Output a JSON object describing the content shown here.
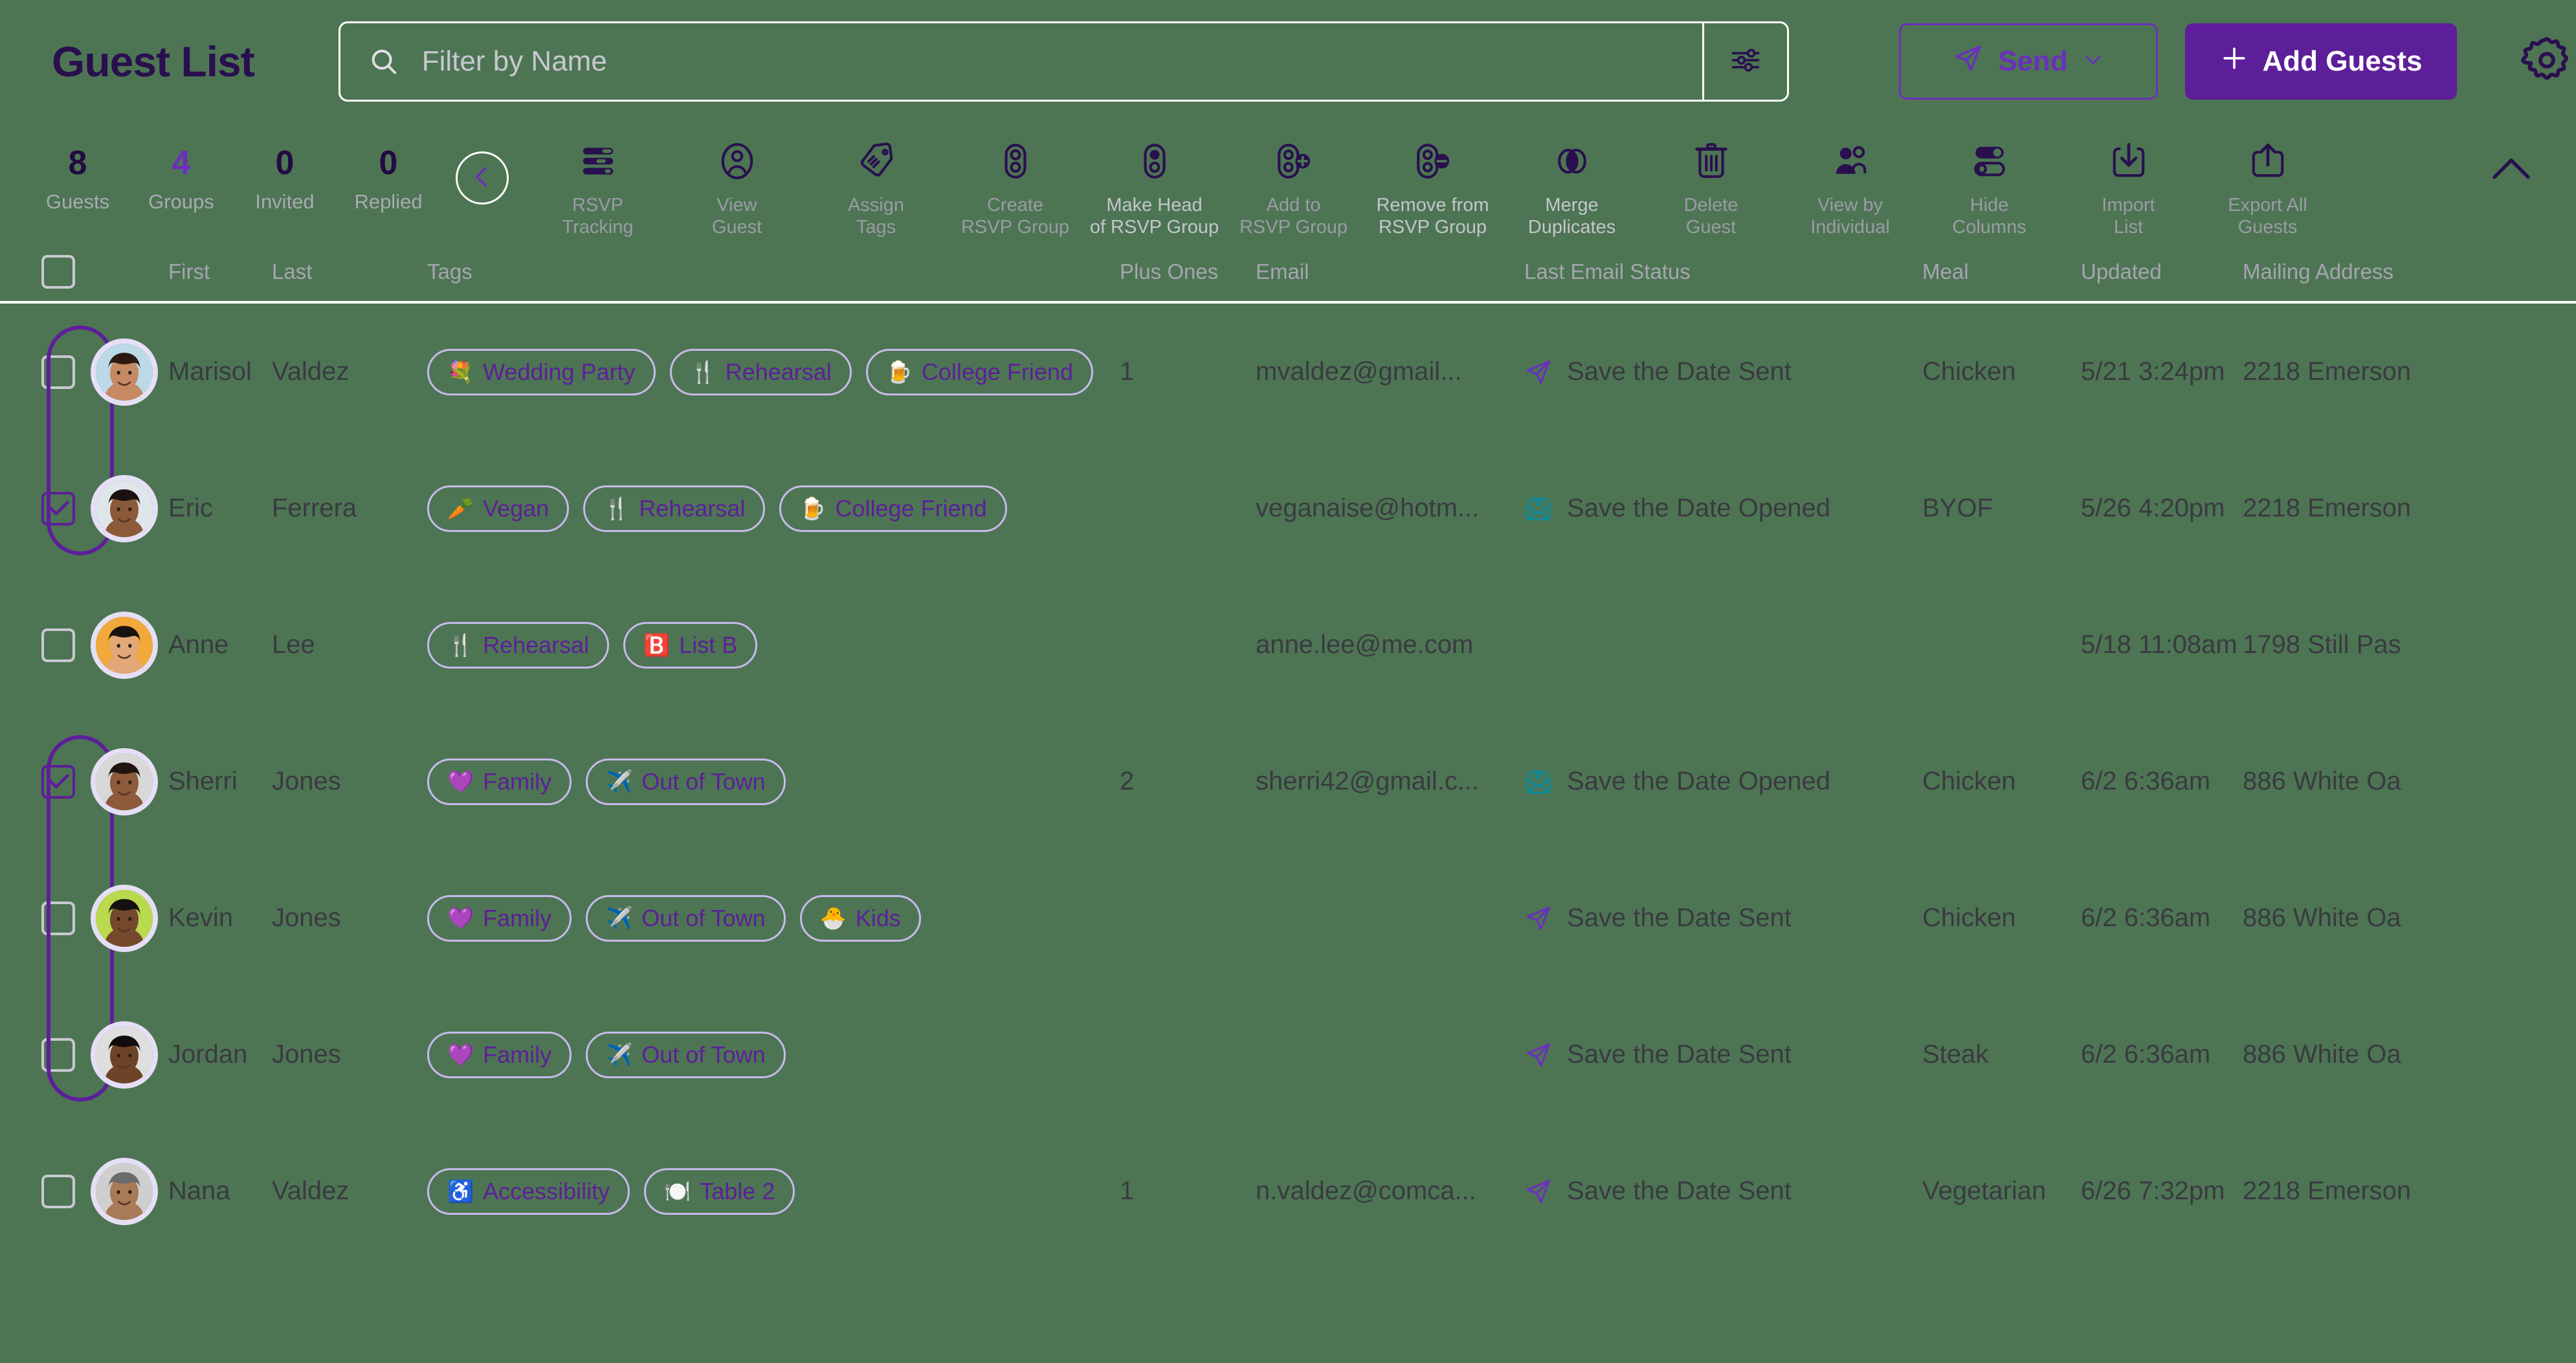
{
  "header": {
    "title": "Guest List",
    "search_placeholder": "Filter by Name",
    "search_value": "",
    "filter_icon": "sliders-icon",
    "search_icon": "search-icon",
    "send_label": "Send",
    "send_icon": "paper-plane-icon",
    "send_chevron": "chevron-down-icon",
    "add_label": "Add Guests",
    "add_icon": "plus-icon",
    "settings_icon": "gear-icon"
  },
  "colors": {
    "background": "#4d7553",
    "title": "#2a0f4f",
    "accent_purple": "#5d1f99",
    "accent_purple_light": "#6b2fbd",
    "tag_border": "#c8b9ec",
    "status_opened_teal": "#0d8c9e",
    "muted_label": "#a5a5b0",
    "disabled_label": "#c5c5cd"
  },
  "stats": [
    {
      "value": "8",
      "label": "Guests",
      "accent": false
    },
    {
      "value": "4",
      "label": "Groups",
      "accent": true
    },
    {
      "value": "0",
      "label": "Invited",
      "accent": false
    },
    {
      "value": "0",
      "label": "Replied",
      "accent": false
    }
  ],
  "collapse_icon": "chevron-left-icon",
  "expand_icon": "chevron-up-icon",
  "tools": [
    {
      "label": "RSVP\nTracking",
      "icon": "rsvp-tracking-icon",
      "disabled": false
    },
    {
      "label": "View\nGuest",
      "icon": "view-guest-icon",
      "disabled": false
    },
    {
      "label": "Assign\nTags",
      "icon": "assign-tags-icon",
      "disabled": false
    },
    {
      "label": "Create\nRSVP Group",
      "icon": "create-rsvp-group-icon",
      "disabled": false
    },
    {
      "label": "Make Head\nof RSVP Group",
      "icon": "make-head-rsvp-group-icon",
      "disabled": true
    },
    {
      "label": "Add to\nRSVP Group",
      "icon": "add-to-rsvp-group-icon",
      "disabled": false
    },
    {
      "label": "Remove from\nRSVP Group",
      "icon": "remove-from-rsvp-group-icon",
      "disabled": true
    },
    {
      "label": "Merge\nDuplicates",
      "icon": "merge-duplicates-icon",
      "disabled": true
    },
    {
      "label": "Delete\nGuest",
      "icon": "delete-guest-icon",
      "disabled": false
    },
    {
      "label": "View by\nIndividual",
      "icon": "view-by-individual-icon",
      "disabled": false
    },
    {
      "label": "Hide\nColumns",
      "icon": "hide-columns-icon",
      "disabled": false
    },
    {
      "label": "Import\nList",
      "icon": "import-list-icon",
      "disabled": false
    },
    {
      "label": "Export All\nGuests",
      "icon": "export-all-guests-icon",
      "disabled": false
    }
  ],
  "table": {
    "columns": [
      "First",
      "Last",
      "Tags",
      "Plus Ones",
      "Email",
      "Last Email Status",
      "Meal",
      "Updated",
      "Mailing Address"
    ],
    "select_all_checked": false,
    "rows": [
      {
        "checked": false,
        "first": "Marisol",
        "last": "Valdez",
        "tags": [
          {
            "emoji": "💐",
            "label": "Wedding Party"
          },
          {
            "emoji": "🍴",
            "label": "Rehearsal"
          },
          {
            "emoji": "🍺",
            "label": "College Friend"
          }
        ],
        "plus_ones": "1",
        "email": "mvaldez@gmail...",
        "status": "Save the Date Sent",
        "status_type": "sent",
        "meal": "Chicken",
        "updated": "5/21 3:24pm",
        "address": "2218 Emerson",
        "avatar": {
          "skin": "#c58a63",
          "hair": "#2c1a12",
          "bg": "#bcd9e8"
        },
        "group": "top"
      },
      {
        "checked": true,
        "first": "Eric",
        "last": "Ferrera",
        "tags": [
          {
            "emoji": "🥕",
            "label": "Vegan"
          },
          {
            "emoji": "🍴",
            "label": "Rehearsal"
          },
          {
            "emoji": "🍺",
            "label": "College Friend"
          }
        ],
        "plus_ones": "",
        "email": "veganaise@hotm...",
        "status": "Save the Date Opened",
        "status_type": "opened",
        "meal": "BYOF",
        "updated": "5/26 4:20pm",
        "address": "2218 Emerson",
        "avatar": {
          "skin": "#8a5a39",
          "hair": "#1b1110",
          "bg": "#dfe6ea"
        },
        "group": "bottom"
      },
      {
        "checked": false,
        "first": "Anne",
        "last": "Lee",
        "tags": [
          {
            "emoji": "🍴",
            "label": "Rehearsal"
          },
          {
            "emoji": "🅱️",
            "label": "List B"
          }
        ],
        "plus_ones": "",
        "email": "anne.lee@me.com",
        "status": "",
        "status_type": "none",
        "meal": "",
        "updated": "5/18 11:08am",
        "address": "1798 Still Pas",
        "avatar": {
          "skin": "#e2a878",
          "hair": "#19130f",
          "bg": "#f0a93a"
        },
        "group": "none"
      },
      {
        "checked": true,
        "first": "Sherri",
        "last": "Jones",
        "tags": [
          {
            "emoji": "💜",
            "label": "Family"
          },
          {
            "emoji": "✈️",
            "label": "Out of Town"
          }
        ],
        "plus_ones": "2",
        "email": "sherri42@gmail.c...",
        "status": "Save the Date Opened",
        "status_type": "opened",
        "meal": "Chicken",
        "updated": "6/2 6:36am",
        "address": "886 White Oa",
        "avatar": {
          "skin": "#8d5b3c",
          "hair": "#221510",
          "bg": "#d8d8d8"
        },
        "group": "top"
      },
      {
        "checked": false,
        "first": "Kevin",
        "last": "Jones",
        "tags": [
          {
            "emoji": "💜",
            "label": "Family"
          },
          {
            "emoji": "✈️",
            "label": "Out of Town"
          },
          {
            "emoji": "🐣",
            "label": "Kids"
          }
        ],
        "plus_ones": "",
        "email": "",
        "status": "Save the Date Sent",
        "status_type": "sent",
        "meal": "Chicken",
        "updated": "6/2 6:36am",
        "address": "886 White Oa",
        "avatar": {
          "skin": "#74492c",
          "hair": "#161010",
          "bg": "#b9da4e"
        },
        "group": "mid"
      },
      {
        "checked": false,
        "first": "Jordan",
        "last": "Jones",
        "tags": [
          {
            "emoji": "💜",
            "label": "Family"
          },
          {
            "emoji": "✈️",
            "label": "Out of Town"
          }
        ],
        "plus_ones": "",
        "email": "",
        "status": "Save the Date Sent",
        "status_type": "sent",
        "meal": "Steak",
        "updated": "6/2 6:36am",
        "address": "886 White Oa",
        "avatar": {
          "skin": "#6d4428",
          "hair": "#120d0c",
          "bg": "#dedede"
        },
        "group": "bottom"
      },
      {
        "checked": false,
        "first": "Nana",
        "last": "Valdez",
        "tags": [
          {
            "emoji": "♿",
            "label": "Accessibility"
          },
          {
            "emoji": "🍽️",
            "label": "Table 2"
          }
        ],
        "plus_ones": "1",
        "email": "n.valdez@comca...",
        "status": "Save the Date Sent",
        "status_type": "sent",
        "meal": "Vegetarian",
        "updated": "6/26 7:32pm",
        "address": "2218 Emerson",
        "avatar": {
          "skin": "#a97a58",
          "hair": "#6b6b6b",
          "bg": "#cfcfcf"
        },
        "group": "none"
      }
    ]
  }
}
